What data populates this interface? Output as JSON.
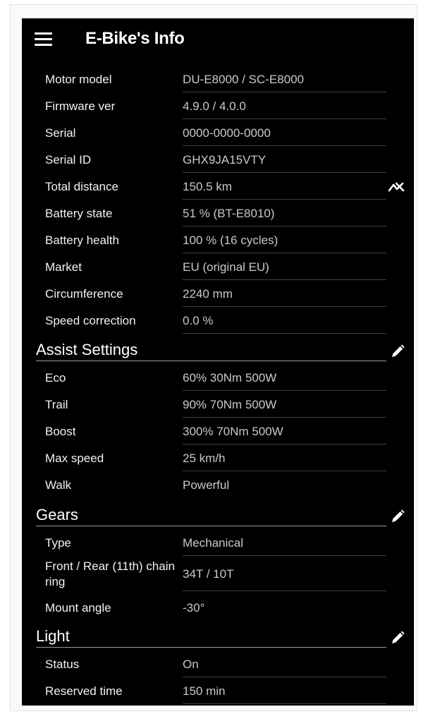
{
  "app": {
    "title": "E-Bike's Info"
  },
  "info": {
    "rows": [
      {
        "label": "Motor model",
        "value": "DU-E8000 / SC-E8000"
      },
      {
        "label": "Firmware ver",
        "value": "4.9.0 / 4.0.0"
      },
      {
        "label": "Serial",
        "value": "0000-0000-0000"
      },
      {
        "label": "Serial ID",
        "value": "GHX9JA15VTY"
      },
      {
        "label": "Total distance",
        "value": "150.5 km"
      },
      {
        "label": "Battery state",
        "value": "51 % (BT-E8010)"
      },
      {
        "label": "Battery health",
        "value": "100 % (16 cycles)"
      },
      {
        "label": "Market",
        "value": "EU (original EU)"
      },
      {
        "label": "Circumference",
        "value": "2240 mm"
      },
      {
        "label": "Speed correction",
        "value": "0.0 %"
      }
    ]
  },
  "assist": {
    "title": "Assist Settings",
    "rows": [
      {
        "label": "Eco",
        "value": "60% 30Nm 500W"
      },
      {
        "label": "Trail",
        "value": "90% 70Nm 500W"
      },
      {
        "label": "Boost",
        "value": "300% 70Nm 500W"
      },
      {
        "label": "Max speed",
        "value": "25 km/h"
      },
      {
        "label": "Walk",
        "value": "Powerful"
      }
    ]
  },
  "gears": {
    "title": "Gears",
    "rows": [
      {
        "label": "Type",
        "value": "Mechanical"
      },
      {
        "label": "Front / Rear (11th) chain ring",
        "value": "34T / 10T"
      },
      {
        "label": "Mount angle",
        "value": "-30°"
      }
    ]
  },
  "light": {
    "title": "Light",
    "rows": [
      {
        "label": "Status",
        "value": "On"
      },
      {
        "label": "Reserved time",
        "value": "150 min"
      }
    ]
  },
  "icons": {
    "menu": "hamburger-menu-icon",
    "trend": "trend-chart-icon",
    "edit": "pencil-edit-icon"
  },
  "colors": {
    "background": "#000000",
    "label": "#f2f2f2",
    "value": "#c9c9c9",
    "accent": "#ffffff"
  }
}
